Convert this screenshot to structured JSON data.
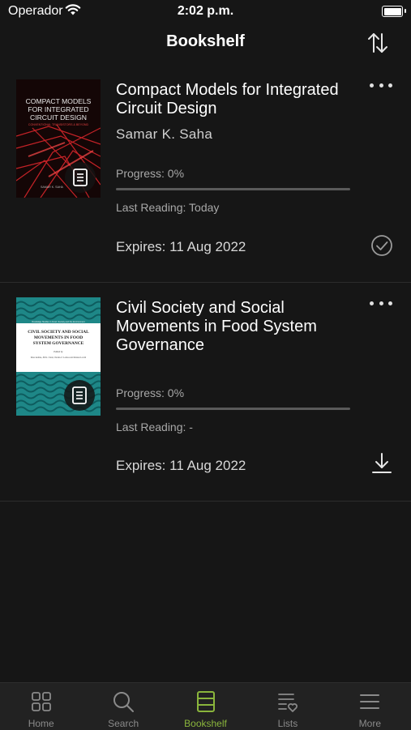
{
  "status_bar": {
    "carrier": "Operador",
    "time": "2:02 p.m."
  },
  "header": {
    "title": "Bookshelf",
    "sort_icon": "sort-arrows-icon"
  },
  "books": [
    {
      "title": "Compact Models for Integrated Circuit Design",
      "author": "Samar K. Saha",
      "progress_label": "Progress: 0%",
      "progress_fraction": 0,
      "last_reading": "Last Reading: Today",
      "expires": "Expires: 11 Aug 2022",
      "status_icon": "downloaded-check-icon",
      "cover_text": {
        "line1": "COMPACT MODELS",
        "line2": "FOR INTEGRATED",
        "line3": "CIRCUIT DESIGN",
        "subtitle": "CONVENTIONAL TRANSISTORS & BEYOND",
        "author": "SAMAR K. SAHA"
      },
      "cover_colors": {
        "bg": "#1a0a0a",
        "accent": "#e0242a"
      }
    },
    {
      "title": "Civil Society and Social Movements in Food System Governance",
      "author": "",
      "progress_label": "Progress: 0%",
      "progress_fraction": 0,
      "last_reading": "Last Reading: -",
      "expires": "Expires: 11 Aug 2022",
      "status_icon": "download-icon",
      "cover_text": {
        "series": "Routledge Studies in Food, Society and the Environment",
        "line1": "CIVIL SOCIETY AND SOCIAL",
        "line2": "MOVEMENTS IN FOOD",
        "line3": "SYSTEM GOVERNANCE",
        "editors_label": "Edited by",
        "editors": "Peter Andrée, Jill K. Clark, Charles Z. Levkoe and Kristen Lowitt"
      },
      "cover_colors": {
        "bg": "#1f8a8a",
        "accent": "#0f5f62"
      }
    }
  ],
  "tab_bar": {
    "tabs": [
      {
        "label": "Home",
        "icon": "grid-icon",
        "active": false
      },
      {
        "label": "Search",
        "icon": "search-icon",
        "active": false
      },
      {
        "label": "Bookshelf",
        "icon": "bookshelf-icon",
        "active": true
      },
      {
        "label": "Lists",
        "icon": "list-heart-icon",
        "active": false
      },
      {
        "label": "More",
        "icon": "menu-icon",
        "active": false
      }
    ],
    "active_color": "#8ab53c",
    "inactive_color": "#8a8a8a"
  }
}
